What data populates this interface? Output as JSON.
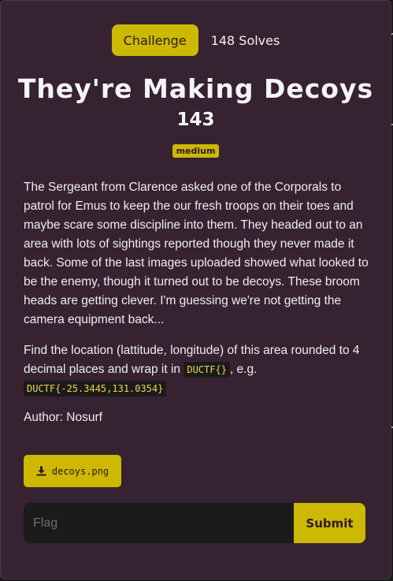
{
  "tabs": {
    "challenge": "Challenge",
    "solves": "148 Solves"
  },
  "challenge": {
    "title": "They're Making Decoys",
    "points": "143",
    "difficulty": "medium",
    "description": "The Sergeant from Clarence asked one of the Corporals to patrol for Emus to keep the our fresh troops on their toes and maybe scare some discipline into them. They headed out to an area with lots of sightings reported though they never made it back. Some of the last images uploaded showed what looked to be the enemy, though it turned out to be decoys. These broom heads are getting clever. I'm guessing we're not getting the camera equipment back...",
    "find_text_before": "Find the location (lattitude, longitude) of this area rounded to 4 decimal places and wrap it in",
    "find_code": "DUCTF{}",
    "find_text_after": ", e.g.",
    "example_code": "DUCTF{-25.3445,131.0354}",
    "author": "Author: Nosurf"
  },
  "file": {
    "label": "decoys.png",
    "icon": "download-icon"
  },
  "flag_form": {
    "placeholder": "Flag",
    "submit_label": "Submit"
  },
  "colors": {
    "accent": "#cdb803",
    "background": "#362231",
    "code_bg": "#1b1b1b"
  }
}
